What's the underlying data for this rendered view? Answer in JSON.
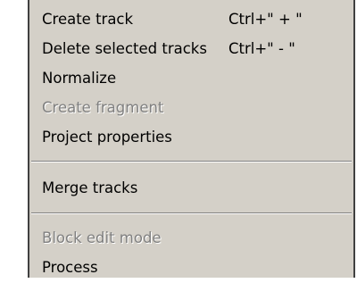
{
  "menu": {
    "items": [
      {
        "label": "Create track",
        "shortcut": "Ctrl+\" + \"",
        "enabled": true
      },
      {
        "label": "Delete selected tracks",
        "shortcut": "Ctrl+\" - \"",
        "enabled": true
      },
      {
        "label": "Normalize",
        "shortcut": "",
        "enabled": true
      },
      {
        "label": "Create fragment",
        "shortcut": "",
        "enabled": false
      },
      {
        "label": "Project properties",
        "shortcut": "",
        "enabled": true
      },
      {
        "label": "Merge tracks",
        "shortcut": "",
        "enabled": true
      },
      {
        "label": "Block edit mode",
        "shortcut": "",
        "enabled": false
      },
      {
        "label": "Process",
        "shortcut": "",
        "enabled": true
      }
    ]
  }
}
